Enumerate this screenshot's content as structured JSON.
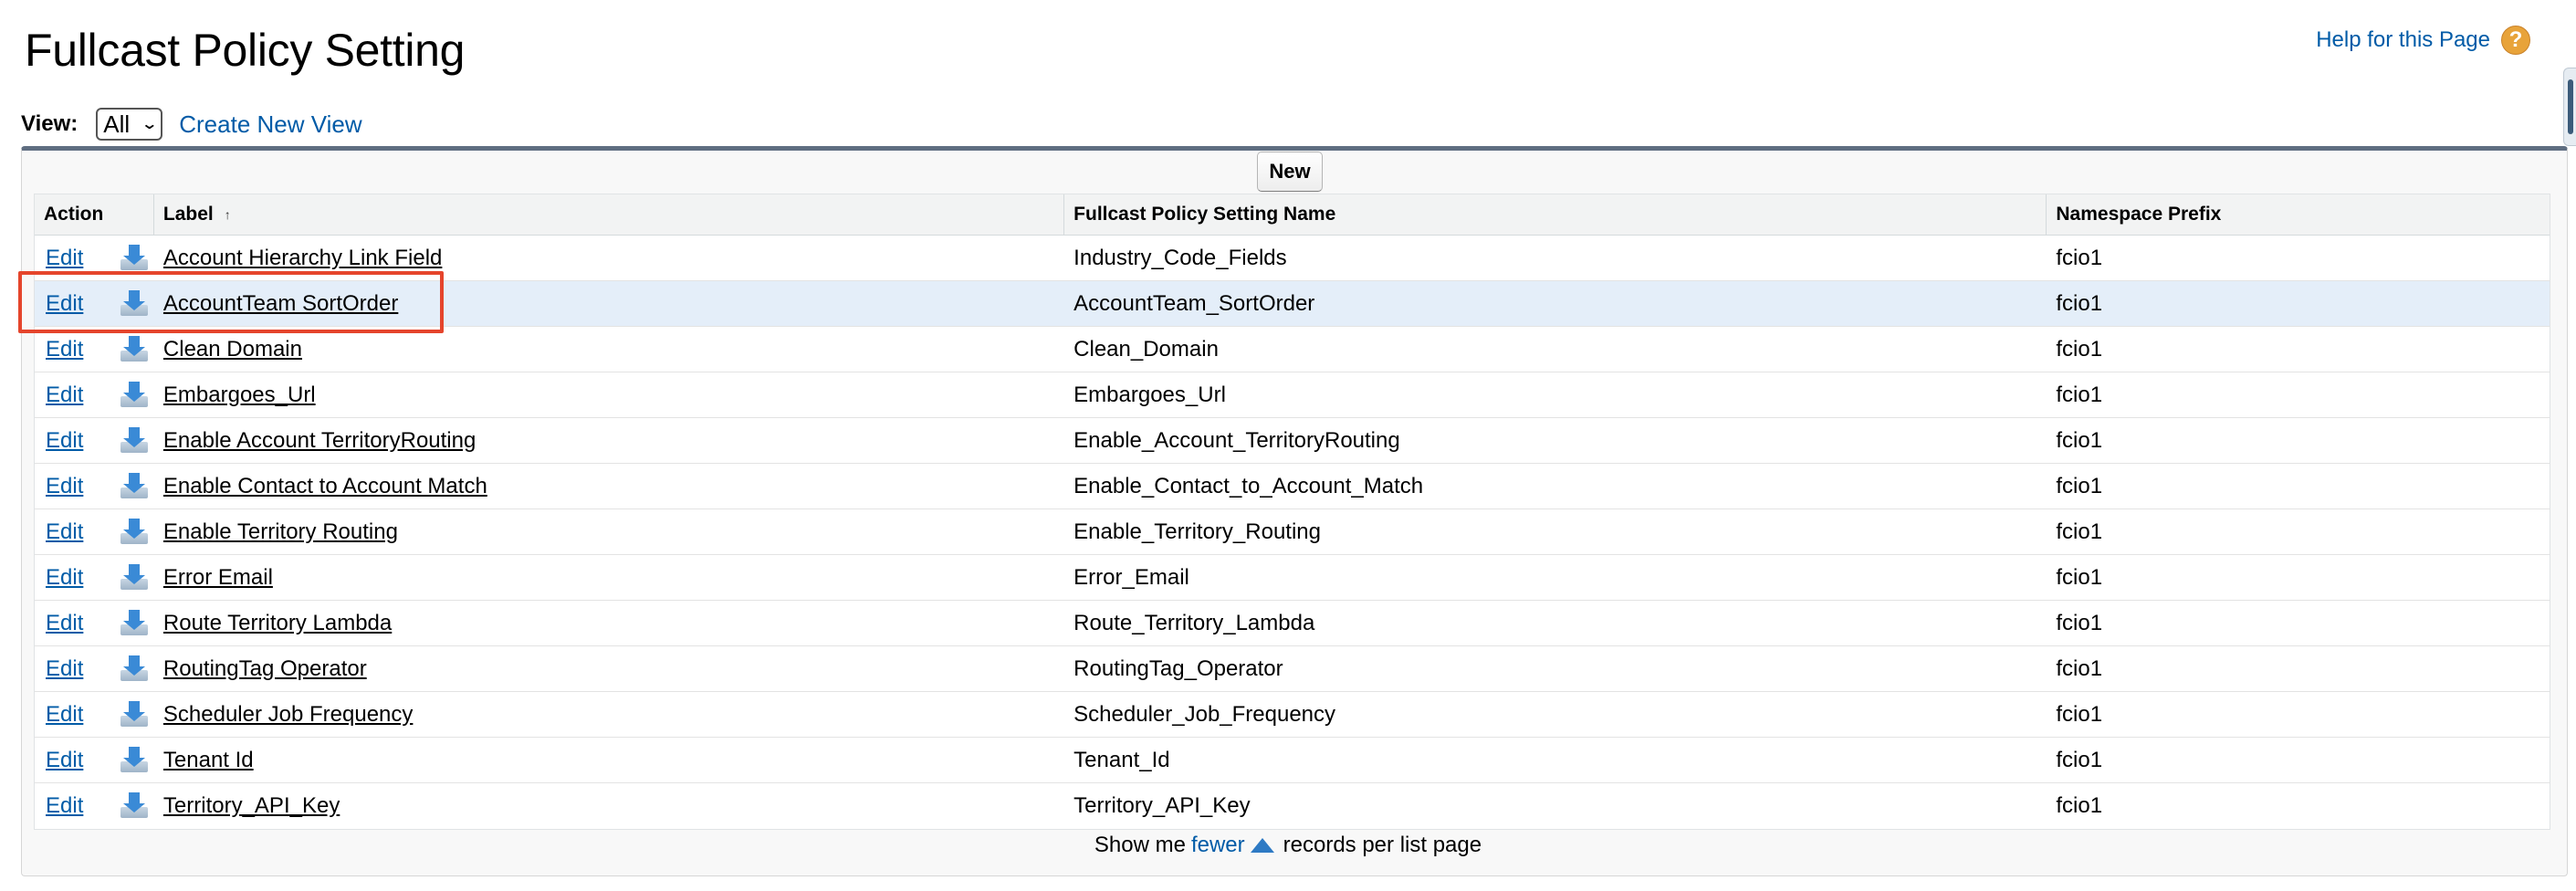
{
  "page": {
    "title": "Fullcast Policy Setting"
  },
  "help": {
    "label": "Help for this Page",
    "icon_glyph": "?",
    "icon": "help-icon"
  },
  "view": {
    "label": "View:",
    "selected": "All",
    "create_link": "Create New View"
  },
  "toolbar": {
    "new_label": "New"
  },
  "table": {
    "headers": {
      "action": "Action",
      "label": "Label",
      "name": "Fullcast Policy Setting Name",
      "namespace": "Namespace Prefix"
    },
    "sort_indicator": "↑",
    "edit_label": "Edit",
    "rows": [
      {
        "label": "Account Hierarchy Link Field",
        "name": "Industry_Code_Fields",
        "namespace": "fcio1"
      },
      {
        "label": "AccountTeam SortOrder",
        "name": "AccountTeam_SortOrder",
        "namespace": "fcio1"
      },
      {
        "label": "Clean Domain",
        "name": "Clean_Domain",
        "namespace": "fcio1"
      },
      {
        "label": "Embargoes_Url",
        "name": "Embargoes_Url",
        "namespace": "fcio1"
      },
      {
        "label": "Enable Account TerritoryRouting",
        "name": "Enable_Account_TerritoryRouting",
        "namespace": "fcio1"
      },
      {
        "label": "Enable Contact to Account Match",
        "name": "Enable_Contact_to_Account_Match",
        "namespace": "fcio1"
      },
      {
        "label": "Enable Territory Routing",
        "name": "Enable_Territory_Routing",
        "namespace": "fcio1"
      },
      {
        "label": "Error Email",
        "name": "Error_Email",
        "namespace": "fcio1"
      },
      {
        "label": "Route Territory Lambda",
        "name": "Route_Territory_Lambda",
        "namespace": "fcio1"
      },
      {
        "label": "RoutingTag Operator",
        "name": "RoutingTag_Operator",
        "namespace": "fcio1"
      },
      {
        "label": "Scheduler Job Frequency",
        "name": "Scheduler_Job_Frequency",
        "namespace": "fcio1"
      },
      {
        "label": "Tenant Id",
        "name": "Tenant_Id",
        "namespace": "fcio1"
      },
      {
        "label": "Territory_API_Key",
        "name": "Territory_API_Key",
        "namespace": "fcio1"
      }
    ]
  },
  "footer": {
    "prefix": "Show me",
    "link": "fewer",
    "suffix": "records per list page"
  },
  "colors": {
    "link": "#015ba7",
    "highlight_row": "#e4eef9",
    "annotation": "#e5452c",
    "panel_border": "#5f6e81"
  }
}
